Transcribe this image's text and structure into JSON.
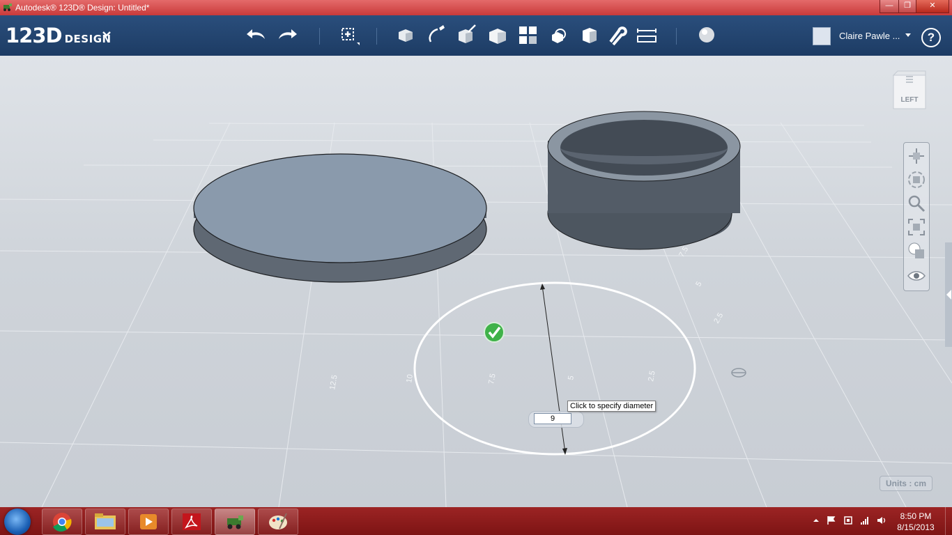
{
  "window": {
    "title": "Autodesk® 123D® Design: Untitled*",
    "controls": {
      "minimize": "—",
      "maximize": "❐",
      "close": "✕"
    }
  },
  "app": {
    "logo_number": "123D",
    "logo_word": "DESIGN",
    "toolbar_icons": [
      "undo-icon",
      "redo-icon",
      "transform-icon",
      "primitives-icon",
      "sketch-icon",
      "construct-icon",
      "modify-icon",
      "pattern-icon",
      "group-icon",
      "combine-icon",
      "snap-icon",
      "measure-icon",
      "material-icon"
    ],
    "user_name": "Claire Pawle ...",
    "help": "?",
    "accent_color": "#2a4e7c"
  },
  "viewport": {
    "viewcube_label": "LEFT",
    "grid_labels": [
      "12.5",
      "10",
      "7.5",
      "5",
      "2.5",
      "2.5",
      "5",
      "7.5"
    ],
    "tooltip": "Click to specify diameter",
    "diameter_value": "9",
    "units": "Units : cm",
    "nav_icons": [
      "pan-icon",
      "orbit-icon",
      "zoom-icon",
      "fit-icon",
      "view-mode-icon",
      "visibility-icon"
    ]
  },
  "taskbar": {
    "apps": [
      "chrome-icon",
      "file-explorer-icon",
      "media-player-icon",
      "acrobat-icon",
      "123d-design-icon",
      "paint-icon"
    ],
    "time": "8:50 PM",
    "date": "8/15/2013",
    "taskbar_color": "#8b1a1a"
  }
}
